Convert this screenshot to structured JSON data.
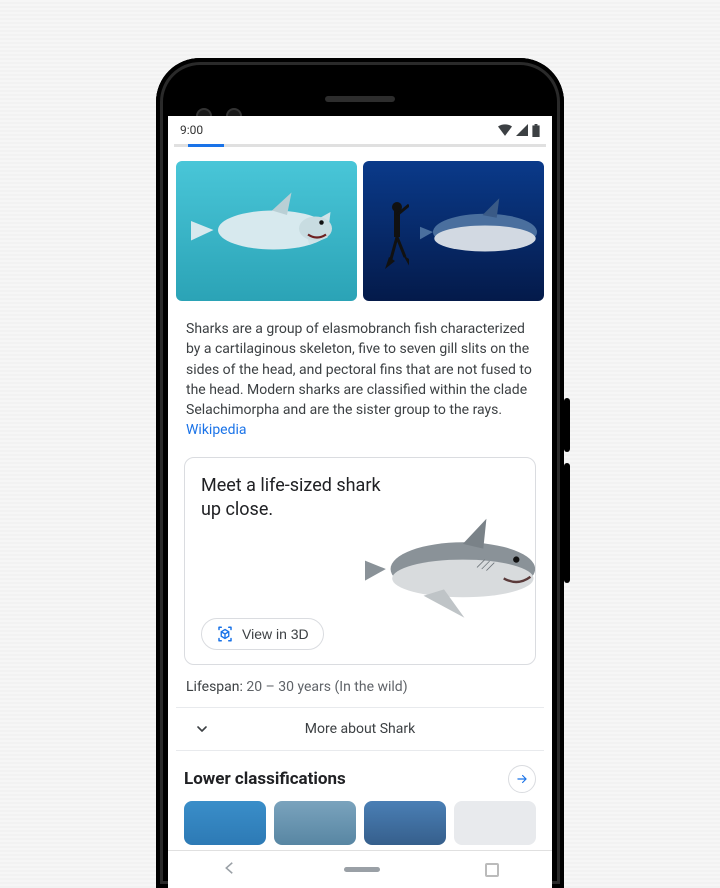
{
  "status": {
    "time": "9:00"
  },
  "knowledge": {
    "description": "Sharks are a group of elasmobranch fish characterized by a cartilaginous skeleton, five to seven gill slits on the sides of the head, and pectoral fins that are not fused to the head. Modern sharks are classified within the clade Selachimorpha and are the sister group to the rays.",
    "source_label": "Wikipedia"
  },
  "ar_card": {
    "title": "Meet a life-sized shark up close.",
    "button_label": "View in 3D"
  },
  "facts": {
    "lifespan_label": "Lifespan:",
    "lifespan_value": "20 – 30 years (In the wild)"
  },
  "expand": {
    "label": "More about Shark"
  },
  "section": {
    "title": "Lower classifications"
  }
}
